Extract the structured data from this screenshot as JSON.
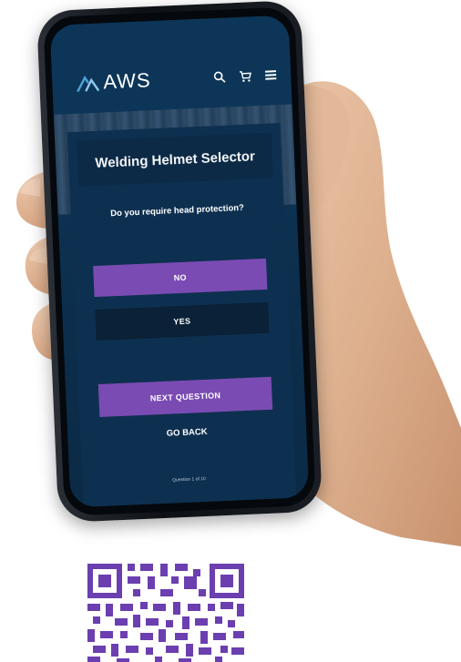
{
  "colors": {
    "screen_background": "#0d3557",
    "accent_purple": "#7a4bb3",
    "button_dark": "#0a2137",
    "qr_purple": "#6b3fb0"
  },
  "header": {
    "logo_text": "AWS",
    "logo_icon": "aws-arc-icon",
    "icons": [
      "search-icon",
      "cart-icon",
      "menu-icon"
    ]
  },
  "selector": {
    "title": "Welding Helmet Selector",
    "question": "Do you require head protection?",
    "options": [
      {
        "label": "NO",
        "selected": true
      },
      {
        "label": "YES",
        "selected": false
      }
    ],
    "next_label": "NEXT QUESTION",
    "back_label": "GO BACK",
    "progress_text": "Question 1 of 10"
  },
  "qr": {
    "icon": "qr-code-icon"
  }
}
